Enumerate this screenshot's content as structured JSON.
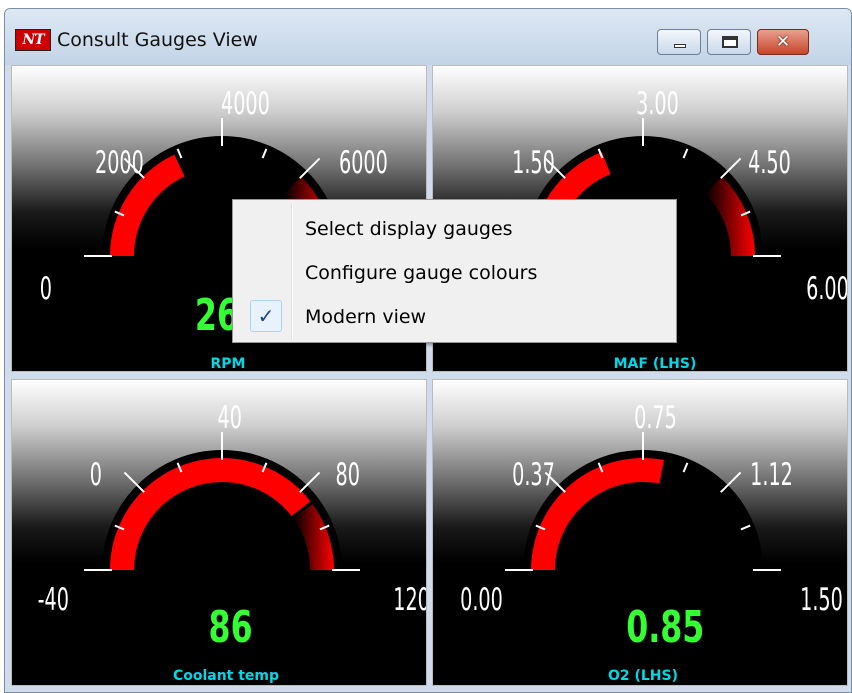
{
  "window": {
    "title": "Consult Gauges View",
    "app_icon_text": "NT",
    "controls": {
      "minimize": "minimize",
      "maximize": "maximize",
      "close": "✕"
    }
  },
  "colors": {
    "needle": "#ff0000",
    "value_text": "#33ff33",
    "label_text": "#00d8e8",
    "tick": "#ffffff"
  },
  "gauges": [
    {
      "name": "RPM",
      "value_text": "268",
      "ticks": [
        "0",
        "2000",
        "4000",
        "6000"
      ],
      "level": 0.36,
      "redzone_from": 0.75
    },
    {
      "name": "MAF (LHS)",
      "value_text": "",
      "ticks": [
        "1.50",
        "3.00",
        "4.50",
        "6.00"
      ],
      "level": 0.38,
      "redzone_from": 0.75
    },
    {
      "name": "Coolant temp",
      "value_text": "86",
      "ticks": [
        "-40",
        "0",
        "40",
        "80",
        "120"
      ],
      "level": 0.79,
      "redzone_from": 0.8,
      "lowzone_to": 0.25
    },
    {
      "name": "O2 (LHS)",
      "value_text": "0.85",
      "ticks": [
        "0.00",
        "0.37",
        "0.75",
        "1.12",
        "1.50"
      ],
      "level": 0.56
    }
  ],
  "context_menu": {
    "items": [
      {
        "label": "Select display gauges",
        "checked": false
      },
      {
        "label": "Configure gauge colours",
        "checked": false
      },
      {
        "label": "Modern view",
        "checked": true
      }
    ],
    "check_glyph": "✓"
  }
}
